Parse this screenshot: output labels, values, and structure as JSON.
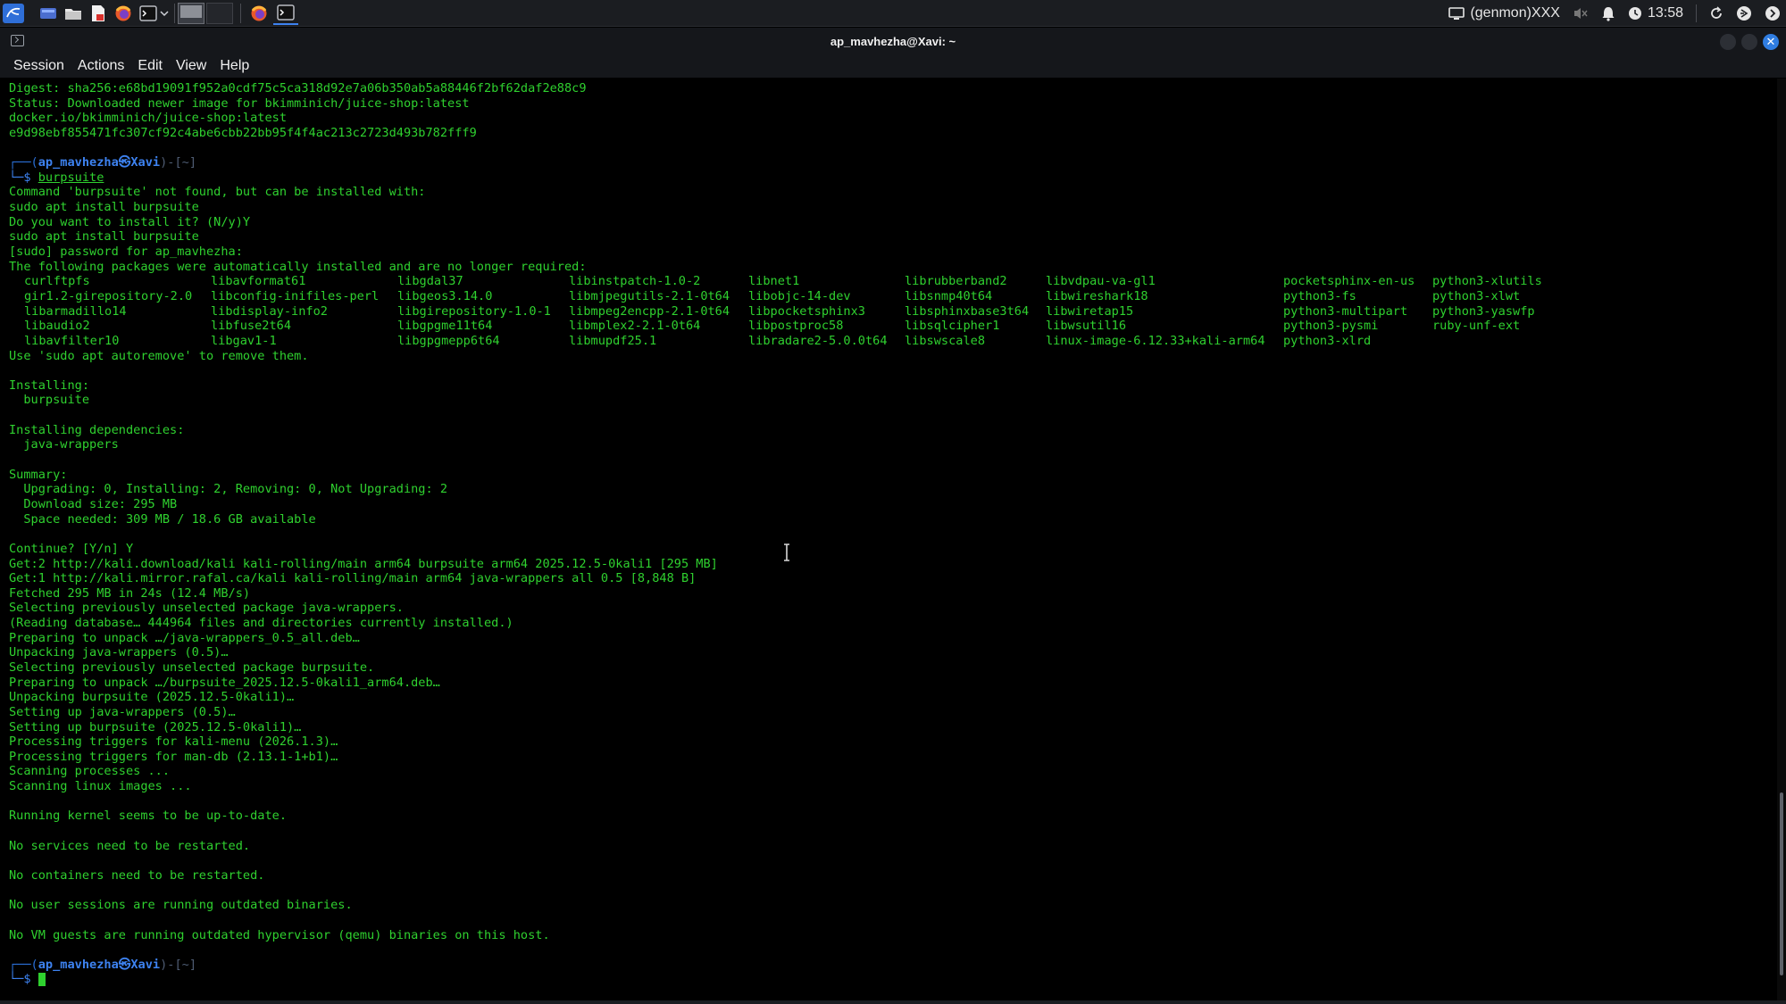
{
  "panel": {
    "right": {
      "display_label": "(genmon)XXX",
      "clock": "13:58"
    },
    "icons": [
      "kali-menu-icon",
      "desktop-icon",
      "file-manager-icon",
      "text-editor-icon",
      "firefox-icon",
      "terminal-icon",
      "dropdown-icon",
      "workspace-1",
      "workspace-2",
      "firefox-task-icon",
      "terminal-task-icon"
    ]
  },
  "window": {
    "title": "ap_mavhezha@Xavi: ~"
  },
  "menu": {
    "session": "Session",
    "actions": "Actions",
    "edit": "Edit",
    "view": "View",
    "help": "Help"
  },
  "prompt": {
    "top_left": "┌──(",
    "user": "ap_mavhezha㉿Xavi",
    "top_right": ")-[~]",
    "dollar": "└─$ "
  },
  "terminal": {
    "block1": [
      "Digest: sha256:e68bd19091f952a0cdf75c5ca318d92e7a06b350ab5a88446f2bf62daf2e88c9",
      "Status: Downloaded newer image for bkimminich/juice-shop:latest",
      "docker.io/bkimminich/juice-shop:latest",
      "e9d98ebf855471fc307cf92c4abe6cbb22bb95f4f4ac213c2723d493b782fff9",
      ""
    ],
    "command1": "burpsuite",
    "block2": [
      "Command 'burpsuite' not found, but can be installed with:",
      "sudo apt install burpsuite",
      "Do you want to install it? (N/y)Y",
      "sudo apt install burpsuite",
      "[sudo] password for ap_mavhezha:",
      "The following packages were automatically installed and are no longer required:"
    ],
    "packages": [
      [
        "curlftpfs",
        "libavformat61",
        "libgdal37",
        "libinstpatch-1.0-2",
        "libnet1",
        "librubberband2",
        "libvdpau-va-gl1",
        "pocketsphinx-en-us",
        "python3-xlutils"
      ],
      [
        "gir1.2-girepository-2.0",
        "libconfig-inifiles-perl",
        "libgeos3.14.0",
        "libmjpegutils-2.1-0t64",
        "libobjc-14-dev",
        "libsnmp40t64",
        "libwireshark18",
        "python3-fs",
        "python3-xlwt"
      ],
      [
        "libarmadillo14",
        "libdisplay-info2",
        "libgirepository-1.0-1",
        "libmpeg2encpp-2.1-0t64",
        "libpocketsphinx3",
        "libsphinxbase3t64",
        "libwiretap15",
        "python3-multipart",
        "python3-yaswfp"
      ],
      [
        "libaudio2",
        "libfuse2t64",
        "libgpgme11t64",
        "libmplex2-2.1-0t64",
        "libpostproc58",
        "libsqlcipher1",
        "libwsutil16",
        "python3-pysmi",
        "ruby-unf-ext"
      ],
      [
        "libavfilter10",
        "libgav1-1",
        "libgpgmepp6t64",
        "libmupdf25.1",
        "libradare2-5.0.0t64",
        "libswscale8",
        "linux-image-6.12.33+kali-arm64",
        "python3-xlrd",
        ""
      ]
    ],
    "block3": [
      "Use 'sudo apt autoremove' to remove them.",
      "",
      "Installing:",
      "  burpsuite",
      "",
      "Installing dependencies:",
      "  java-wrappers",
      "",
      "Summary:",
      "  Upgrading: 0, Installing: 2, Removing: 0, Not Upgrading: 2",
      "  Download size: 295 MB",
      "  Space needed: 309 MB / 18.6 GB available",
      "",
      "Continue? [Y/n] Y",
      "Get:2 http://kali.download/kali kali-rolling/main arm64 burpsuite arm64 2025.12.5-0kali1 [295 MB]",
      "Get:1 http://kali.mirror.rafal.ca/kali kali-rolling/main arm64 java-wrappers all 0.5 [8,848 B]",
      "Fetched 295 MB in 24s (12.4 MB/s)",
      "Selecting previously unselected package java-wrappers.",
      "(Reading database… 444964 files and directories currently installed.)",
      "Preparing to unpack …/java-wrappers_0.5_all.deb…",
      "Unpacking java-wrappers (0.5)…",
      "Selecting previously unselected package burpsuite.",
      "Preparing to unpack …/burpsuite_2025.12.5-0kali1_arm64.deb…",
      "Unpacking burpsuite (2025.12.5-0kali1)…",
      "Setting up java-wrappers (0.5)…",
      "Setting up burpsuite (2025.12.5-0kali1)…",
      "Processing triggers for kali-menu (2026.1.3)…",
      "Processing triggers for man-db (2.13.1-1+b1)…",
      "Scanning processes ...",
      "Scanning linux images ...",
      "",
      "Running kernel seems to be up-to-date.",
      "",
      "No services need to be restarted.",
      "",
      "No containers need to be restarted.",
      "",
      "No user sessions are running outdated binaries.",
      "",
      "No VM guests are running outdated hypervisor (qemu) binaries on this host.",
      ""
    ],
    "command2": ""
  },
  "colors": {
    "output_green": "#2fd12f",
    "prompt_blue": "#3d82f0",
    "panel_bg": "#1b1d21",
    "close_button": "#2f7de1"
  }
}
